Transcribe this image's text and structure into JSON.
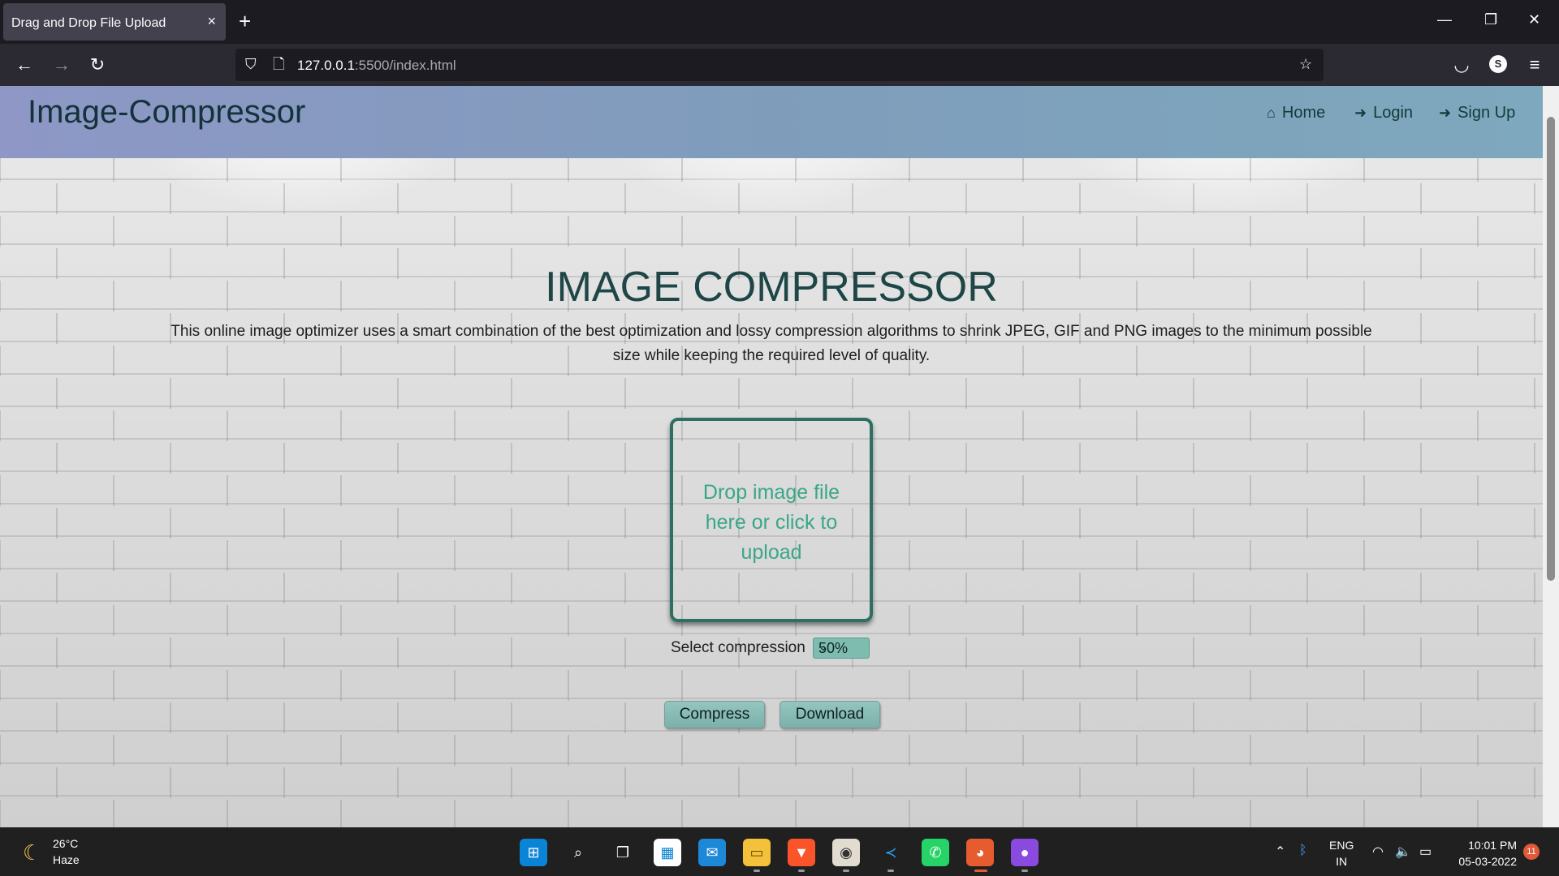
{
  "browser": {
    "tab_title": "Drag and Drop File Upload",
    "tab_close": "×",
    "new_tab": "+",
    "url_host": "127.0.0.1",
    "url_rest": ":5500/index.html",
    "profile_initial": "S",
    "window_controls": {
      "minimize": "—",
      "restore": "❐",
      "close": "✕"
    }
  },
  "page": {
    "brand": "Image-Compressor",
    "menu": [
      {
        "label": "Home",
        "icon": "home-icon"
      },
      {
        "label": "Login",
        "icon": "sign-in-icon"
      },
      {
        "label": "Sign Up",
        "icon": "sign-in-icon"
      }
    ],
    "title": "IMAGE COMPRESSOR",
    "description": "This online image optimizer uses a smart combination of the best optimization and lossy compression algorithms to shrink JPEG, GIF and PNG images to the minimum possible size while keeping the required level of quality.",
    "dropzone_text": "Drop image file here or click to upload",
    "compression_label": "Select compression",
    "compression_value": "50%",
    "compress_button": "Compress",
    "download_button": "Download",
    "colors": {
      "accent": "#2e6e63",
      "dropzone_text": "#3aa688",
      "header_start": "#8e97c6",
      "header_end": "#7ea8bd"
    }
  },
  "taskbar": {
    "temperature": "26°C",
    "condition": "Haze",
    "language_line1": "ENG",
    "language_line2": "IN",
    "time": "10:01 PM",
    "date": "05-03-2022",
    "notification_count": "11",
    "apps": [
      "windows-start-icon",
      "search-icon",
      "task-view-icon",
      "microsoft-store-icon",
      "mail-icon",
      "file-explorer-icon",
      "brave-icon",
      "chrome-icon",
      "vscode-icon",
      "whatsapp-icon",
      "firefox-icon",
      "github-icon"
    ]
  }
}
